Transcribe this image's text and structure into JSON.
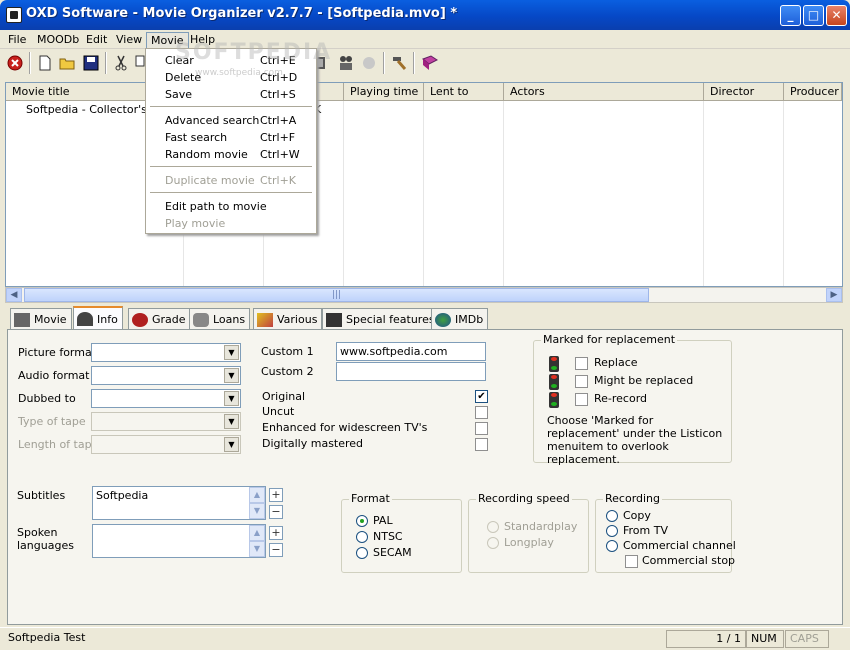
{
  "window": {
    "title": "OXD Software - Movie Organizer v2.7.7 - [Softpedia.mvo] *",
    "minimize": "_",
    "maximize": "□",
    "close": "✕"
  },
  "menubar": [
    "File",
    "MOODb",
    "Edit",
    "View",
    "Movie",
    "Help"
  ],
  "watermark": "SOFTPEDIA",
  "watermark_small": "www.softpedia.com",
  "dropdown": [
    {
      "label": "Clear",
      "shortcut": "Ctrl+E",
      "enabled": true
    },
    {
      "label": "Delete",
      "shortcut": "Ctrl+D",
      "enabled": true
    },
    {
      "label": "Save",
      "shortcut": "Ctrl+S",
      "enabled": true
    },
    {
      "label": "Advanced search",
      "shortcut": "Ctrl+A",
      "enabled": true
    },
    {
      "label": "Fast search",
      "shortcut": "Ctrl+F",
      "enabled": true
    },
    {
      "label": "Random movie",
      "shortcut": "Ctrl+W",
      "enabled": true
    },
    {
      "label": "Duplicate movie",
      "shortcut": "Ctrl+K",
      "enabled": false
    },
    {
      "label": "Edit path to movie",
      "shortcut": "",
      "enabled": true
    },
    {
      "label": "Play movie",
      "shortcut": "",
      "enabled": false
    }
  ],
  "list": {
    "columns": [
      "Movie title",
      "Playing time",
      "Lent to",
      "Actors",
      "Director",
      "Producer"
    ],
    "rows": [
      {
        "title": "Softpedia - Collector's Edition",
        "extra": "K"
      }
    ]
  },
  "tabs": [
    "Movie",
    "Info",
    "Grade",
    "Loans",
    "Various",
    "Special features",
    "IMDb"
  ],
  "info": {
    "picture_format": "Picture format",
    "audio_format": "Audio format",
    "dubbed_to": "Dubbed to",
    "type_of_tape": "Type of tape",
    "length_of_tape": "Length of tape",
    "custom1_label": "Custom 1",
    "custom1_value": "www.softpedia.com",
    "custom2_label": "Custom 2",
    "custom2_value": "",
    "original": "Original",
    "uncut": "Uncut",
    "widescreen": "Enhanced for widescreen TV's",
    "digital": "Digitally mastered",
    "subtitles_label": "Subtitles",
    "subtitles_value": "Softpedia",
    "spoken_label": "Spoken languages",
    "spoken_value": ""
  },
  "marked": {
    "title": "Marked for replacement",
    "replace": "Replace",
    "might": "Might be replaced",
    "rerecord": "Re-record",
    "note": "Choose 'Marked for replacement' under the Listicon menuitem to overlook replacement."
  },
  "format": {
    "title": "Format",
    "options": [
      "PAL",
      "NTSC",
      "SECAM"
    ],
    "selected": "PAL"
  },
  "speed": {
    "title": "Recording speed",
    "options": [
      "Standardplay",
      "Longplay"
    ]
  },
  "recording": {
    "title": "Recording",
    "options": [
      "Copy",
      "From TV",
      "Commercial channel"
    ],
    "commercial_stop": "Commercial stop"
  },
  "status": {
    "left": "Softpedia Test",
    "page": "1 / 1",
    "num": "NUM",
    "caps": "CAPS"
  }
}
